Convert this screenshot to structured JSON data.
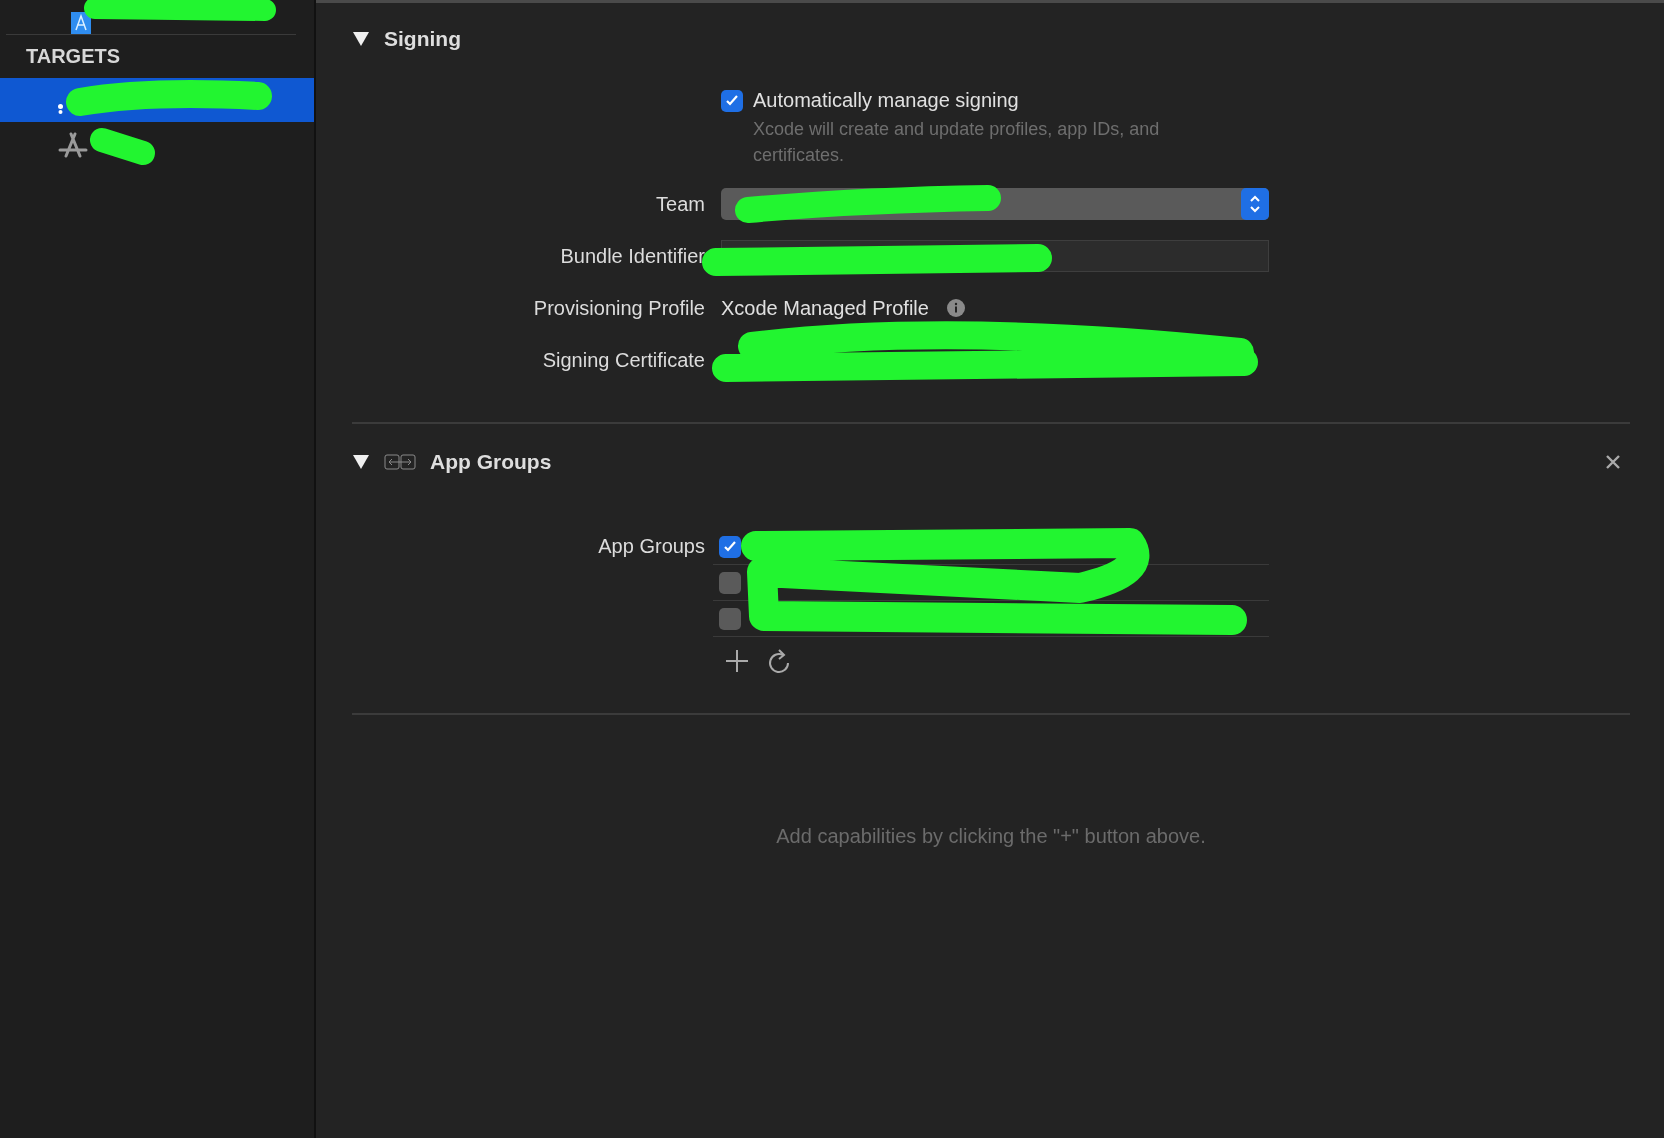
{
  "sidebar": {
    "targets_header": "TARGETS",
    "targets": [
      {
        "kind": "app",
        "selected": true
      },
      {
        "kind": "appstore",
        "selected": false
      }
    ]
  },
  "signing": {
    "title": "Signing",
    "expanded": true,
    "auto_manage": {
      "label": "Automatically manage signing",
      "checked": true,
      "hint": "Xcode will create and update profiles, app IDs, and certificates."
    },
    "fields": [
      {
        "kind": "popup",
        "label": "Team"
      },
      {
        "kind": "text_field",
        "label": "Bundle Identifier"
      },
      {
        "kind": "profile",
        "label": "Provisioning Profile",
        "value": "Xcode Managed Profile"
      },
      {
        "kind": "text",
        "label": "Signing Certificate"
      }
    ]
  },
  "app_groups": {
    "title": "App Groups",
    "expanded": true,
    "label": "App Groups",
    "groups": [
      {
        "checked": true
      },
      {
        "checked": false
      },
      {
        "checked": false
      }
    ]
  },
  "empty_message": "Add capabilities by clicking the \"+\" button above."
}
